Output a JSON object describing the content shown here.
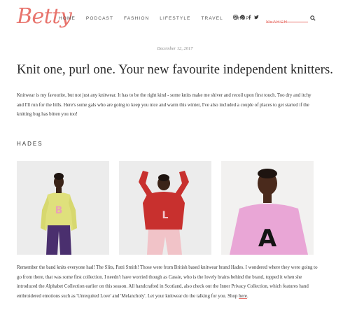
{
  "header": {
    "logo": "Betty",
    "nav": [
      "HOME",
      "PODCAST",
      "FASHION",
      "LIFESTYLE",
      "TRAVEL",
      "SHOP"
    ],
    "social_icons": [
      "instagram-icon",
      "pinterest-icon",
      "facebook-icon",
      "twitter-icon"
    ],
    "search_placeholder": "SEARCH"
  },
  "post": {
    "date": "December 12, 2017",
    "title": "Knit one, purl one. Your new favourite independent knitters.",
    "intro": "Knitwear is my favourite, but not just any knitwear. It has to be the right kind - some knits make me shiver and recoil upon first touch. Too dry and itchy and I'll run for the hills. Here's some gals who are going to keep you nice and warm this winter, I've also included a couple of places to get started if the knitting bug has bitten you too!",
    "section_heading": "HADES",
    "photos": [
      {
        "name": "model-yellow-jumper-photo",
        "sweater_letter": "B"
      },
      {
        "name": "model-red-jumper-photo",
        "sweater_letter": "L"
      },
      {
        "name": "model-pink-jumper-photo",
        "sweater_letter": "A"
      }
    ],
    "body": "Remember the band knits everyone had! The Slits, Patti Smith! Those were from British based knitwear brand Hades. I wondered where they were going to go from there, that was some first collection. I needn't have worried though as Cassie, who is the lovely brains behind the brand, topped it when she introduced the Alphabet Collection earlier on this season. All handcrafted in Scotland, also check out the Inner Privacy Collection, which features hand embroidered emotions such as 'Unrequited Love' and 'Melancholy'. Let your knitwear do the talking for you. Shop ",
    "shop_link": "here",
    "body_end": "."
  }
}
